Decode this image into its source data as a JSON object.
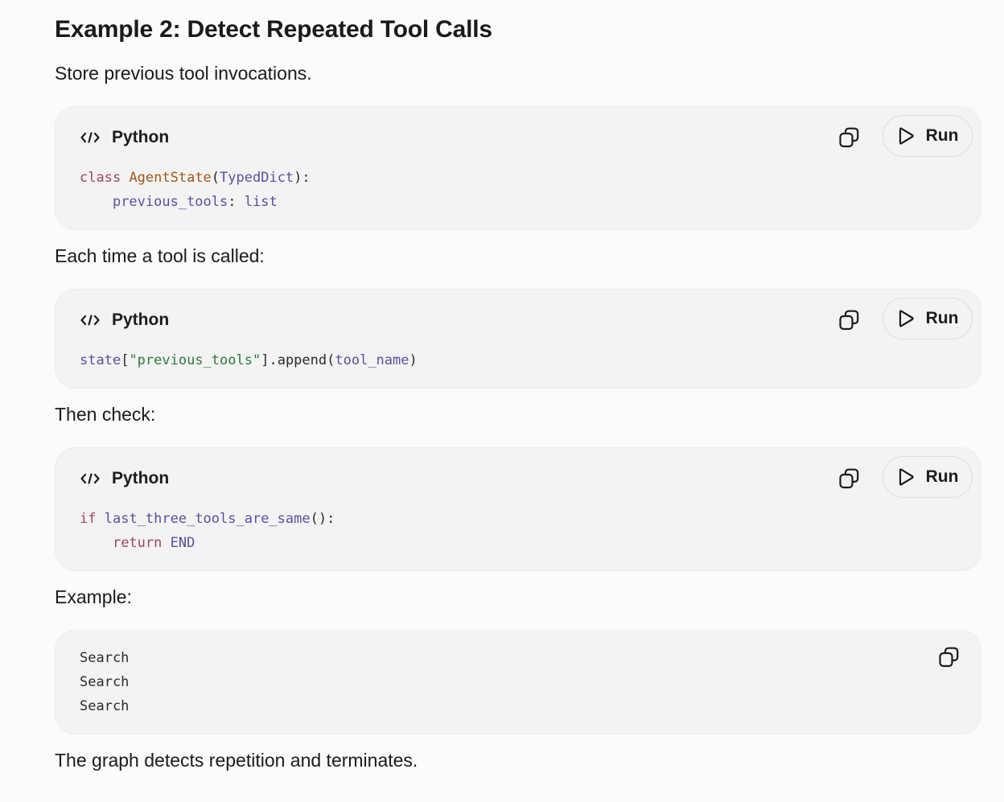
{
  "heading": "Example 2: Detect Repeated Tool Calls",
  "intro": "Store previous tool invocations.",
  "para_each_time": "Each time a tool is called:",
  "para_then_check": "Then check:",
  "para_example": "Example:",
  "para_conclusion": "The graph detects repetition and terminates.",
  "block1": {
    "lang": "Python",
    "run_label": "Run",
    "line1": {
      "kw": "class",
      "cls": "AgentState",
      "open": "(",
      "base": "TypedDict",
      "close": "):"
    },
    "line2": {
      "indent": "    ",
      "attr": "previous_tools",
      "colon": ": ",
      "type": "list"
    }
  },
  "block2": {
    "lang": "Python",
    "run_label": "Run",
    "line1": {
      "var": "state",
      "lb": "[",
      "key": "\"previous_tools\"",
      "rb": "]",
      "dot": ".",
      "method": "append",
      "open": "(",
      "arg": "tool_name",
      "close": ")"
    }
  },
  "block3": {
    "lang": "Python",
    "run_label": "Run",
    "line1": {
      "kw": "if",
      "sp": " ",
      "fn": "last_three_tools_are_same",
      "call": "():"
    },
    "line2": {
      "indent": "    ",
      "kw": "return",
      "sp": " ",
      "val": "END"
    }
  },
  "block4": {
    "lines": [
      "Search",
      "Search",
      "Search"
    ]
  },
  "icons": {
    "code": "code-brackets-icon",
    "copy": "copy-icon",
    "play": "play-icon"
  }
}
